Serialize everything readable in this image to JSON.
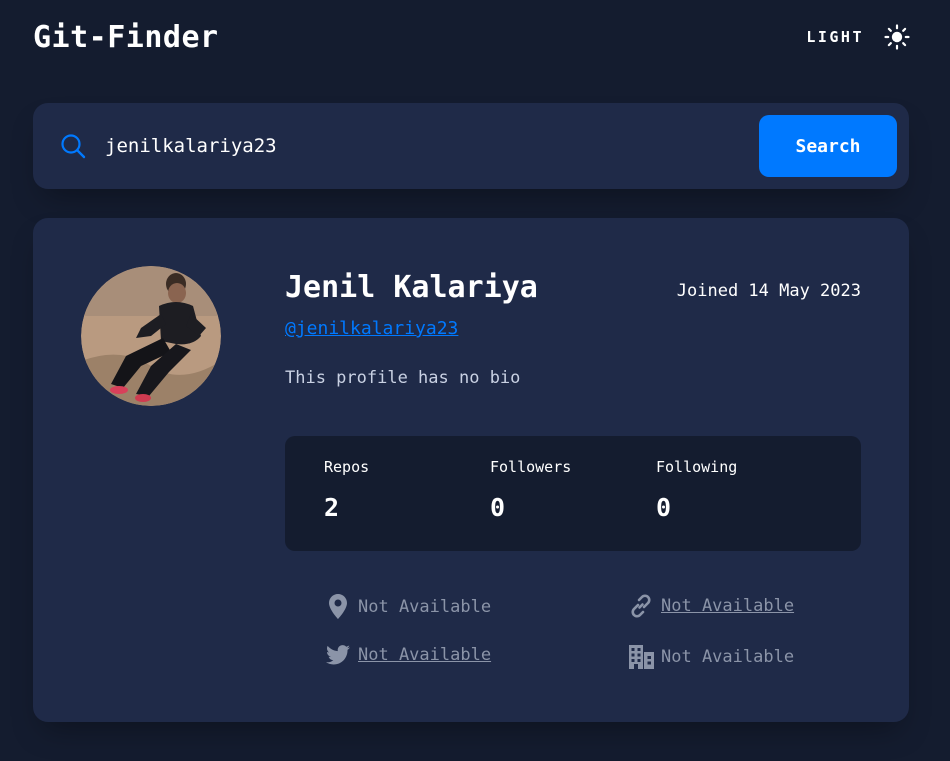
{
  "app": {
    "title": "Git-Finder",
    "theme_toggle": {
      "label": "LIGHT",
      "icon": "sun-icon"
    }
  },
  "search": {
    "value": "jenilkalariya23",
    "button_label": "Search",
    "icon": "search-icon"
  },
  "profile": {
    "name": "Jenil Kalariya",
    "username": "@jenilkalariya23",
    "joined": "Joined 14 May 2023",
    "bio": "This profile has no bio",
    "stats": [
      {
        "label": "Repos",
        "value": "2"
      },
      {
        "label": "Followers",
        "value": "0"
      },
      {
        "label": "Following",
        "value": "0"
      }
    ],
    "links": {
      "location": {
        "icon": "location-pin-icon",
        "text": "Not Available"
      },
      "website": {
        "icon": "link-icon",
        "text": "Not Available"
      },
      "twitter": {
        "icon": "twitter-icon",
        "text": "Not Available"
      },
      "company": {
        "icon": "building-icon",
        "text": "Not Available"
      }
    }
  },
  "colors": {
    "background": "#141c2f",
    "card": "#1f2a48",
    "accent": "#0079ff",
    "muted": "#8b94a8"
  }
}
